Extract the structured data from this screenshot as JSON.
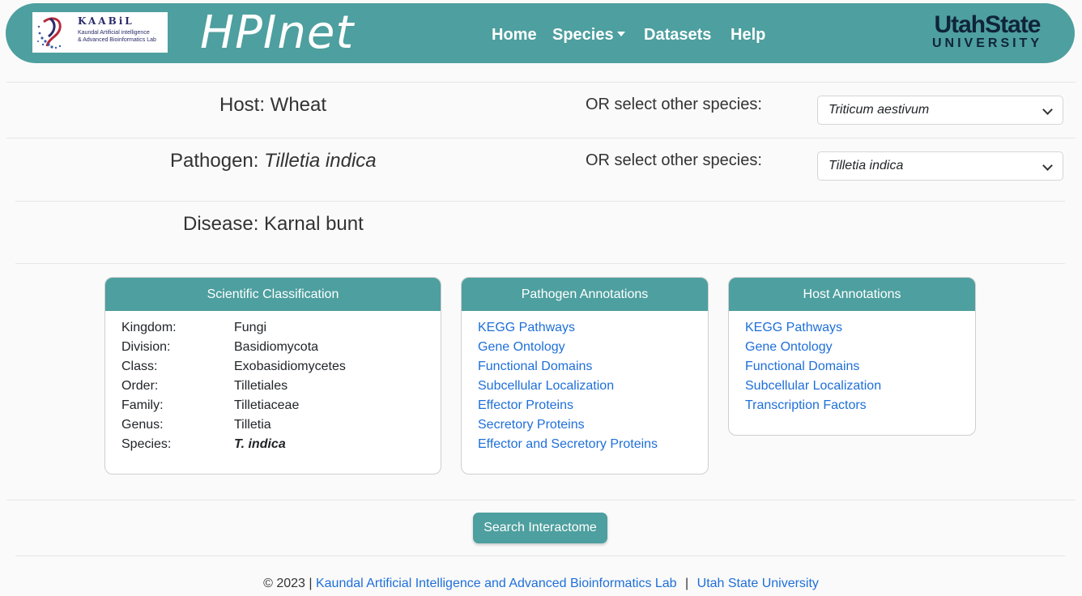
{
  "header": {
    "logo": {
      "title": "KAABiL",
      "subtitle_line1": "Kaundal Artificial intelligence",
      "subtitle_line2": "& Advanced Bioinformatics Lab"
    },
    "brand": "HPInet",
    "nav": {
      "home": "Home",
      "species": "Species",
      "datasets": "Datasets",
      "help": "Help"
    },
    "university": {
      "top": "UtahState",
      "bottom": "UNIVERSITY"
    }
  },
  "host": {
    "label": "Host: Wheat",
    "or_label": "OR select other species:",
    "selected": "Triticum aestivum"
  },
  "pathogen": {
    "label_prefix": "Pathogen: ",
    "name": "Tilletia indica",
    "or_label": "OR select other species:",
    "selected": "Tilletia indica"
  },
  "disease": {
    "label": "Disease: Karnal bunt"
  },
  "classification": {
    "title": "Scientific Classification",
    "rows": [
      {
        "key": "Kingdom:",
        "value": "Fungi"
      },
      {
        "key": "Division:",
        "value": "Basidiomycota"
      },
      {
        "key": "Class:",
        "value": "Exobasidiomycetes"
      },
      {
        "key": "Order:",
        "value": "Tilletiales"
      },
      {
        "key": "Family:",
        "value": "Tilletiaceae"
      },
      {
        "key": "Genus:",
        "value": "Tilletia"
      },
      {
        "key": "Species:",
        "value": "T. indica"
      }
    ]
  },
  "pathogen_annotations": {
    "title": "Pathogen Annotations",
    "links": [
      "KEGG Pathways",
      "Gene Ontology",
      "Functional Domains",
      "Subcellular Localization",
      "Effector Proteins",
      "Secretory Proteins",
      "Effector and Secretory Proteins"
    ]
  },
  "host_annotations": {
    "title": "Host Annotations",
    "links": [
      "KEGG Pathways",
      "Gene Ontology",
      "Functional Domains",
      "Subcellular Localization",
      "Transcription Factors"
    ]
  },
  "actions": {
    "search": "Search Interactome"
  },
  "footer": {
    "copyright": "© 2023 |",
    "lab_link": "Kaundal Artificial Intelligence and Advanced Bioinformatics Lab",
    "separator": "|",
    "university_link": "Utah State University"
  },
  "colors": {
    "accent": "#4e9f9f",
    "link": "#1e6fd9",
    "usu_navy": "#0f2439"
  },
  "icons": {
    "dropdown": "chevron-down-icon",
    "logo": "kaabil-logo-icon"
  }
}
